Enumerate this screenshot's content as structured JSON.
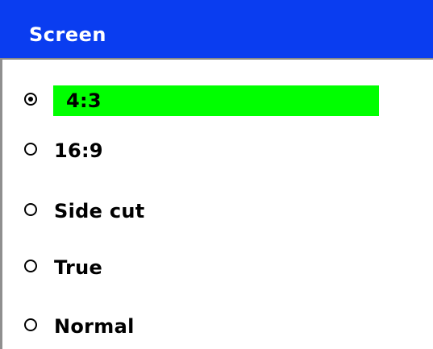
{
  "title": "Screen",
  "options": [
    {
      "label": "4:3",
      "checked": true
    },
    {
      "label": "16:9",
      "checked": false
    },
    {
      "label": "Side cut",
      "checked": false
    },
    {
      "label": "True",
      "checked": false
    },
    {
      "label": "Normal",
      "checked": false
    }
  ],
  "colors": {
    "title_bar": "#0a3df0",
    "selection_highlight": "#00ff00",
    "background": "#ffffff"
  }
}
